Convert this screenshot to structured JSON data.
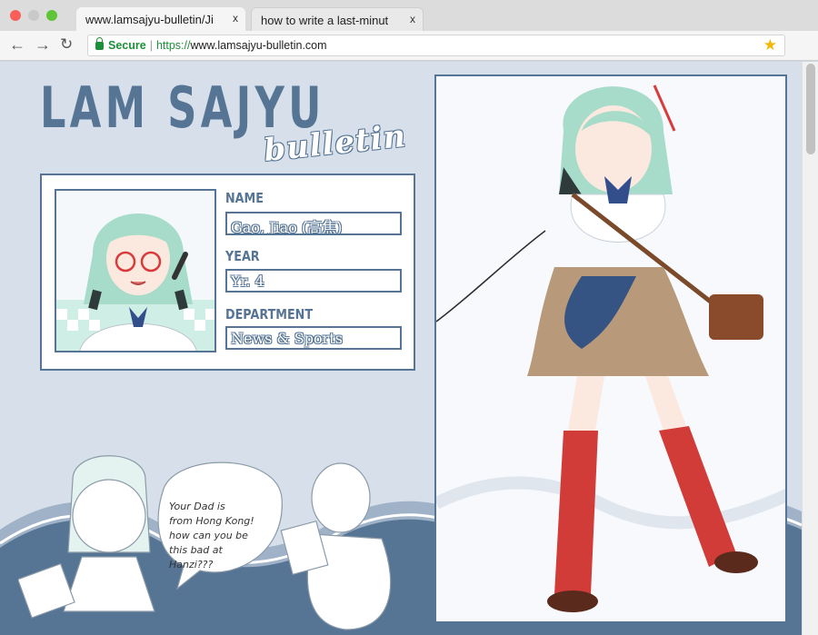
{
  "browser": {
    "tabs": [
      {
        "label": "www.lamsajyu-bulletin/Ji",
        "close": "x",
        "active": true
      },
      {
        "label": "how to write a last-minut",
        "close": "x",
        "active": false
      }
    ],
    "address": {
      "secure_label": "Secure",
      "separator": "|",
      "scheme": "https://",
      "host": "www.lamsajyu-bulletin.com"
    },
    "icons": [
      "back-arrow-icon",
      "forward-arrow-icon",
      "reload-icon",
      "lock-icon",
      "bookmark-star-icon"
    ],
    "accent_color": "#1c8f3a"
  },
  "page": {
    "logo": {
      "main": "LAM SAJYU",
      "sub": "bulletin"
    },
    "profile": {
      "name_label": "NAME",
      "name_value": "Gao, Jiao (高焦)",
      "year_label": "YEAR",
      "year_value": "Yr. 4",
      "department_label": "DEPARTMENT",
      "department_value": "News & Sports"
    },
    "doodle_speech": [
      "Your Dad is",
      "from Hong Kong!",
      "how can you be",
      "this bad at",
      "Hanzi???"
    ],
    "theme_color": "#567494",
    "background_color": "#d7e0ea"
  }
}
